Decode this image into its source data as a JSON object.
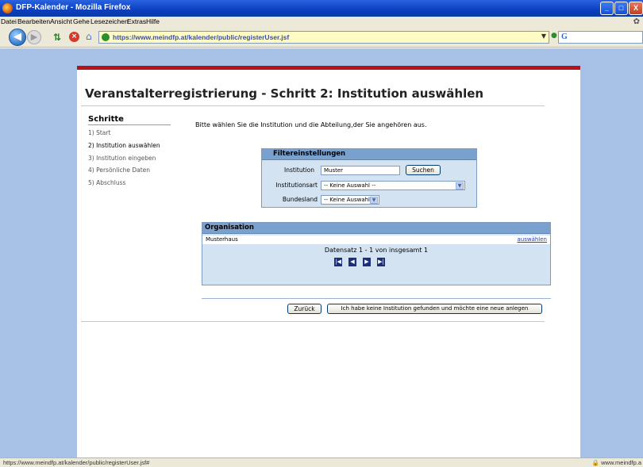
{
  "window": {
    "title": "DFP-Kalender - Mozilla Firefox",
    "minimize": "_",
    "maximize": "□",
    "close": "X"
  },
  "menu": [
    "Datei",
    "Bearbeiten",
    "Ansicht",
    "Gehe",
    "Lesezeichen",
    "Extras",
    "Hilfe"
  ],
  "toolbar": {
    "url": "https://www.meindfp.at/kalender/public/registerUser.jsf",
    "search_logo": "G"
  },
  "page": {
    "heading": "Veranstalterregistrierung - Schritt 2: Institution auswählen",
    "steps_title": "Schritte",
    "steps": [
      "1) Start",
      "2) Institution auswählen",
      "3) Institution eingeben",
      "4) Persönliche Daten",
      "5) Abschluss"
    ],
    "active_step_index": 1,
    "intro": "Bitte wählen Sie die Institution und die Abteilung,der Sie angehören aus."
  },
  "filter": {
    "header": "Filtereinstellungen",
    "institution_label": "Institution",
    "institution_value": "Muster",
    "search_button": "Suchen",
    "type_label": "Institutionsart",
    "type_value": "-- Keine Auswahl --",
    "state_label": "Bundesland",
    "state_value": "-- Keine Auswahl --"
  },
  "results": {
    "header": "Organisation",
    "rows": [
      {
        "name": "Musterhaus",
        "action": "auswählen"
      }
    ],
    "dataset_text": "Datensatz 1 - 1 von insgesamt 1",
    "pager": [
      "first",
      "prev",
      "next",
      "last"
    ]
  },
  "actions": {
    "back": "Zurück",
    "new_institution": "Ich habe keine Institution gefunden und möchte eine neue anlegen"
  },
  "statusbar": {
    "url": "https://www.meindfp.at/kalender/public/registerUser.jsf#",
    "domain": "www.meindfp.a"
  }
}
